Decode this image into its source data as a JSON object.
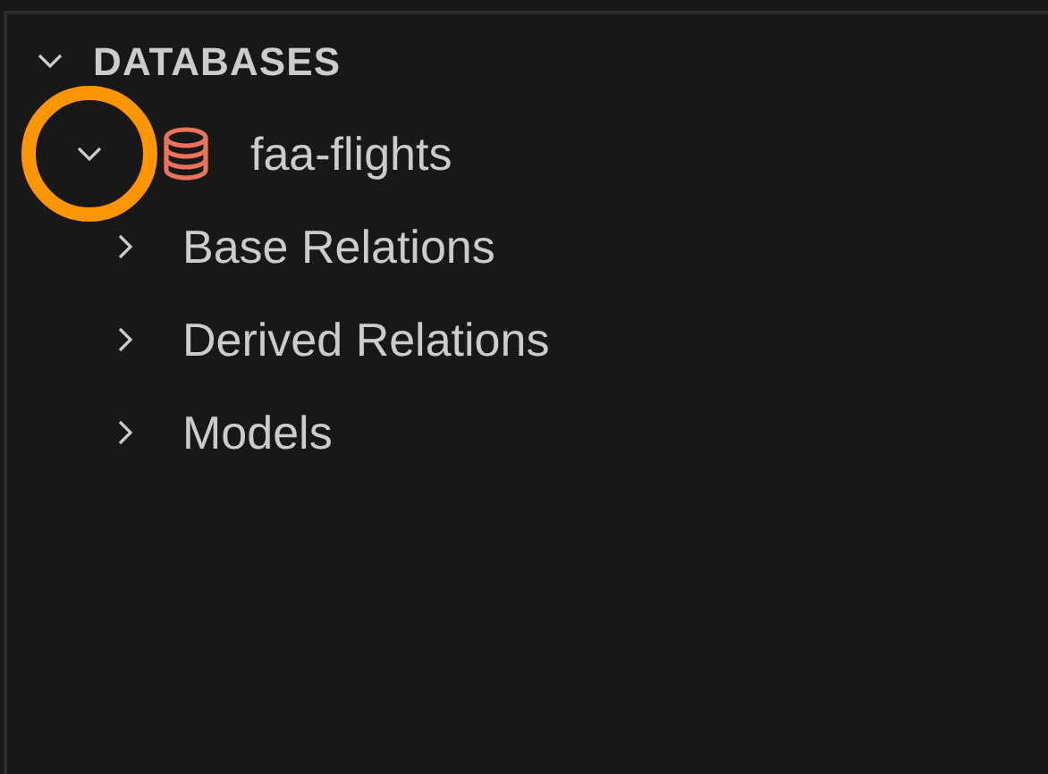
{
  "section": {
    "title": "DATABASES",
    "expanded": true
  },
  "databases": [
    {
      "name": "faa-flights",
      "expanded": true,
      "highlighted": true,
      "children": [
        {
          "name": "Base Relations",
          "expanded": false
        },
        {
          "name": "Derived Relations",
          "expanded": false
        },
        {
          "name": "Models",
          "expanded": false
        }
      ]
    }
  ]
}
